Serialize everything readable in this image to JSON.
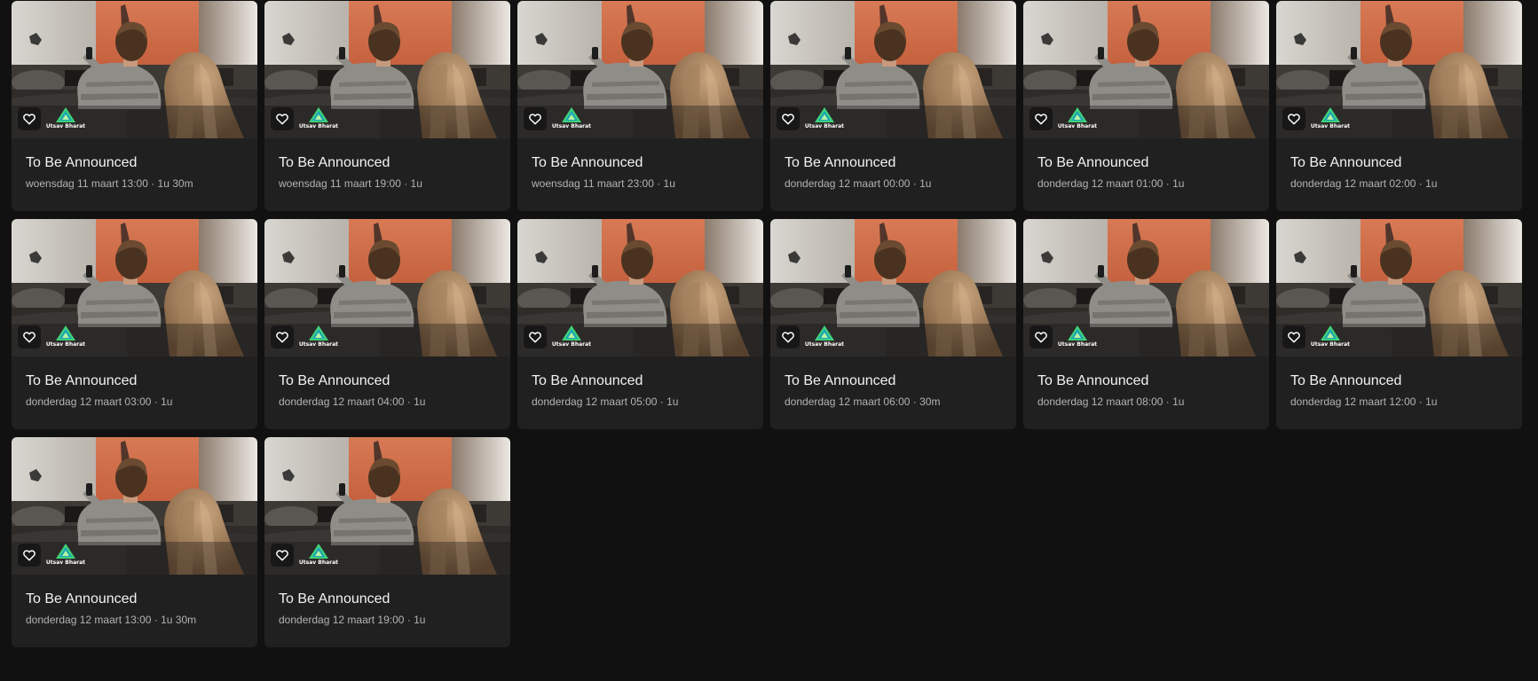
{
  "programs": [
    {
      "title": "To Be Announced",
      "meta": "woensdag 11 maart 13:00 · 1u 30m",
      "channel": "Utsav Bharat"
    },
    {
      "title": "To Be Announced",
      "meta": "woensdag 11 maart 19:00 · 1u",
      "channel": "Utsav Bharat"
    },
    {
      "title": "To Be Announced",
      "meta": "woensdag 11 maart 23:00 · 1u",
      "channel": "Utsav Bharat"
    },
    {
      "title": "To Be Announced",
      "meta": "donderdag 12 maart 00:00 · 1u",
      "channel": "Utsav Bharat"
    },
    {
      "title": "To Be Announced",
      "meta": "donderdag 12 maart 01:00 · 1u",
      "channel": "Utsav Bharat"
    },
    {
      "title": "To Be Announced",
      "meta": "donderdag 12 maart 02:00 · 1u",
      "channel": "Utsav Bharat"
    },
    {
      "title": "To Be Announced",
      "meta": "donderdag 12 maart 03:00 · 1u",
      "channel": "Utsav Bharat"
    },
    {
      "title": "To Be Announced",
      "meta": "donderdag 12 maart 04:00 · 1u",
      "channel": "Utsav Bharat"
    },
    {
      "title": "To Be Announced",
      "meta": "donderdag 12 maart 05:00 · 1u",
      "channel": "Utsav Bharat"
    },
    {
      "title": "To Be Announced",
      "meta": "donderdag 12 maart 06:00 · 30m",
      "channel": "Utsav Bharat"
    },
    {
      "title": "To Be Announced",
      "meta": "donderdag 12 maart 08:00 · 1u",
      "channel": "Utsav Bharat"
    },
    {
      "title": "To Be Announced",
      "meta": "donderdag 12 maart 12:00 · 1u",
      "channel": "Utsav Bharat"
    },
    {
      "title": "To Be Announced",
      "meta": "donderdag 12 maart 13:00 · 1u 30m",
      "channel": "Utsav Bharat"
    },
    {
      "title": "To Be Announced",
      "meta": "donderdag 12 maart 19:00 · 1u",
      "channel": "Utsav Bharat"
    }
  ],
  "icons": {
    "favorite": "heart-outline-icon",
    "channel_logo": "utsav-bharat-logo"
  },
  "colors": {
    "page_background": "#111111",
    "card_background": "#202020",
    "title_text": "#f2f2f2",
    "meta_text": "#b3b3b3",
    "logo_accent": "#3fd17a"
  }
}
